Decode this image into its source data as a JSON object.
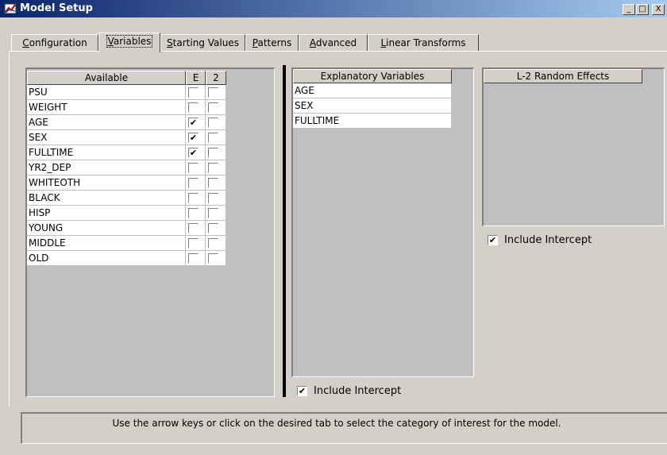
{
  "window": {
    "title": "Model Setup",
    "controls": [
      "_",
      "□",
      "X"
    ]
  },
  "tabs": [
    {
      "label": "Configuration",
      "accel": "C"
    },
    {
      "label": "Variables",
      "accel": "V",
      "selected": true
    },
    {
      "label": "Starting Values",
      "accel": "S"
    },
    {
      "label": "Patterns",
      "accel": "P"
    },
    {
      "label": "Advanced",
      "accel": "A"
    },
    {
      "label": "Linear Transforms",
      "accel": "L"
    }
  ],
  "available": {
    "headers": [
      "Available",
      "E",
      "2"
    ],
    "rows": [
      {
        "name": "PSU",
        "e": false,
        "l2": false
      },
      {
        "name": "WEIGHT",
        "e": false,
        "l2": false
      },
      {
        "name": "AGE",
        "e": true,
        "l2": false
      },
      {
        "name": "SEX",
        "e": true,
        "l2": false
      },
      {
        "name": "FULLTIME",
        "e": true,
        "l2": false
      },
      {
        "name": "YR2_DEP",
        "e": false,
        "l2": false
      },
      {
        "name": "WHITEOTH",
        "e": false,
        "l2": false
      },
      {
        "name": "BLACK",
        "e": false,
        "l2": false
      },
      {
        "name": "HISP",
        "e": false,
        "l2": false
      },
      {
        "name": "YOUNG",
        "e": false,
        "l2": false
      },
      {
        "name": "MIDDLE",
        "e": false,
        "l2": false
      },
      {
        "name": "OLD",
        "e": false,
        "l2": false
      }
    ]
  },
  "explanatory": {
    "header": "Explanatory Variables",
    "rows": [
      "AGE",
      "SEX",
      "FULLTIME"
    ],
    "include_intercept_label": "Include Intercept",
    "include_intercept_checked": true
  },
  "random_effects": {
    "header": "L-2 Random Effects",
    "rows": [],
    "include_intercept_label": "Include Intercept",
    "include_intercept_checked": true
  },
  "status": {
    "message": "Use the arrow keys or click on the desired tab to select the category of interest for the model."
  },
  "check_glyph": "✔"
}
